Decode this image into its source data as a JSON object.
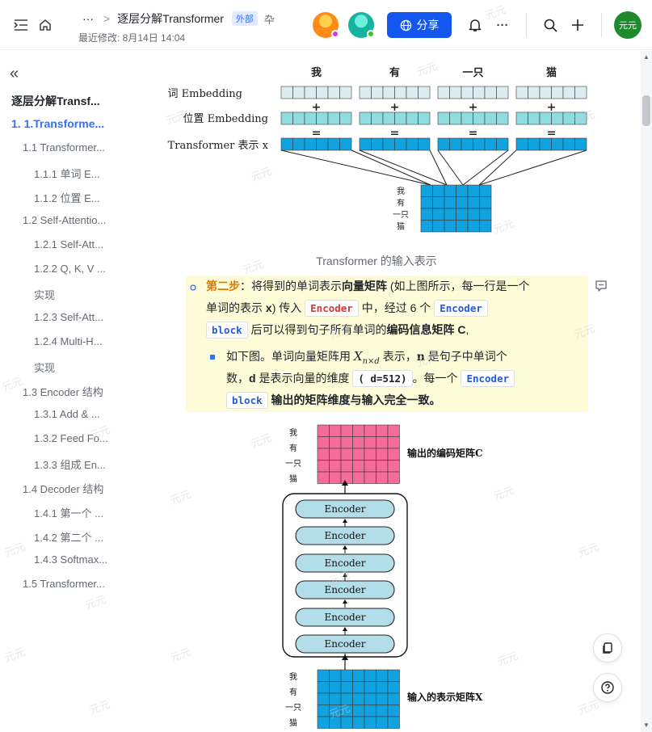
{
  "header": {
    "ellipsis": "···",
    "breadcrumb_sep": ">",
    "doc_title": "逐层分解Transformer",
    "external_badge": "外部",
    "pin_glyph": "卆",
    "last_modified": "最近修改: 8月14日 14:04",
    "share_label": "分享",
    "user_avatar_label": "元元",
    "icons": [
      "sidebar-toggle-icon",
      "home-icon",
      "bell-icon",
      "more-icon",
      "search-icon",
      "plus-icon"
    ]
  },
  "sidebar": {
    "collapse_glyph": "«",
    "items": [
      {
        "label": "逐层分解Transf..."
      },
      {
        "label": "1. 1.Transforme..."
      },
      {
        "label": "1.1 Transformer..."
      },
      {
        "label": "1.1.1 单词 E..."
      },
      {
        "label": "1.1.2 位置 E..."
      },
      {
        "label": "1.2 Self-Attentio..."
      },
      {
        "label": "1.2.1 Self-Att..."
      },
      {
        "label": "1.2.2 Q, K, V ..."
      },
      {
        "label": "实现"
      },
      {
        "label": "1.2.3 Self-Att..."
      },
      {
        "label": "1.2.4 Multi-H..."
      },
      {
        "label": "实现"
      },
      {
        "label": "1.3 Encoder 结构"
      },
      {
        "label": "1.3.1 Add & ..."
      },
      {
        "label": "1.3.2 Feed Fo..."
      },
      {
        "label": "1.3.3 组成 En..."
      },
      {
        "label": "1.4 Decoder 结构"
      },
      {
        "label": "1.4.1 第一个 ..."
      },
      {
        "label": "1.4.2 第二个 ..."
      },
      {
        "label": "1.4.3 Softmax..."
      },
      {
        "label": "1.5 Transformer..."
      }
    ]
  },
  "figure1": {
    "words": [
      "我",
      "有",
      "一只",
      "猫"
    ],
    "row_labels": [
      "词 Embedding",
      "位置 Embedding",
      "Transformer 表示 x"
    ],
    "plus": "+",
    "equals": "=",
    "matrix_labels": [
      "我",
      "有",
      "一只",
      "猫"
    ],
    "caption": "Transformer 的输入表示"
  },
  "callout": {
    "step_label": "第二步",
    "line1_a": "：将得到的单词表示",
    "line1_b": "向量矩阵",
    "line1_c": " (如上图所示，每一行是一个",
    "line2_a": "单词的表示 ",
    "line2_b": "x",
    "line2_c": ") 传入 ",
    "code_encoder": "Encoder",
    "line2_d": " 中，经过 6 个 ",
    "code_encoder_block_1": "Encoder",
    "code_block_1": "block",
    "line3_a": " 后可以得到句子所有单词的",
    "line3_b": "编码信息矩阵 C",
    "line3_c": ",",
    "sub_line1_a": "如下图。单词向量矩阵用 ",
    "math_symbol": "X",
    "math_sub": "n×d",
    "sub_line1_b": " 表示，",
    "sub_line1_n": "n",
    "sub_line1_c": " 是句子中单词个",
    "sub_line2_a": "数，",
    "sub_line2_d": "d",
    "sub_line2_b": " 是表示向量的维度 ",
    "code_d": "( d=512)",
    "sub_line2_c": "。每一个 ",
    "code_encoder_block_2": "Encoder",
    "code_block_2": "block",
    "sub_line3": " 输出的矩阵维度与输入完全一致。"
  },
  "figure2": {
    "row_labels_top": [
      "我",
      "有",
      "一只",
      "猫"
    ],
    "output_label": "输出的编码矩阵C",
    "encoder_label": "Encoder",
    "encoder_count": 6,
    "row_labels_bottom": [
      "我",
      "有",
      "一只",
      "猫"
    ],
    "input_label": "输入的表示矩阵X"
  },
  "watermark": "元元",
  "colors": {
    "brand_blue": "#1456f0",
    "accent_blue": "#3370ff",
    "highlight_orange": "#de7802",
    "callout_bg": "#fefbd9",
    "word_emb": "#dcedf0",
    "pos_emb": "#8fdde0",
    "repr": "#10a3e0",
    "output_matrix": "#f56b9a",
    "encoder_box": "#b3dde8"
  }
}
